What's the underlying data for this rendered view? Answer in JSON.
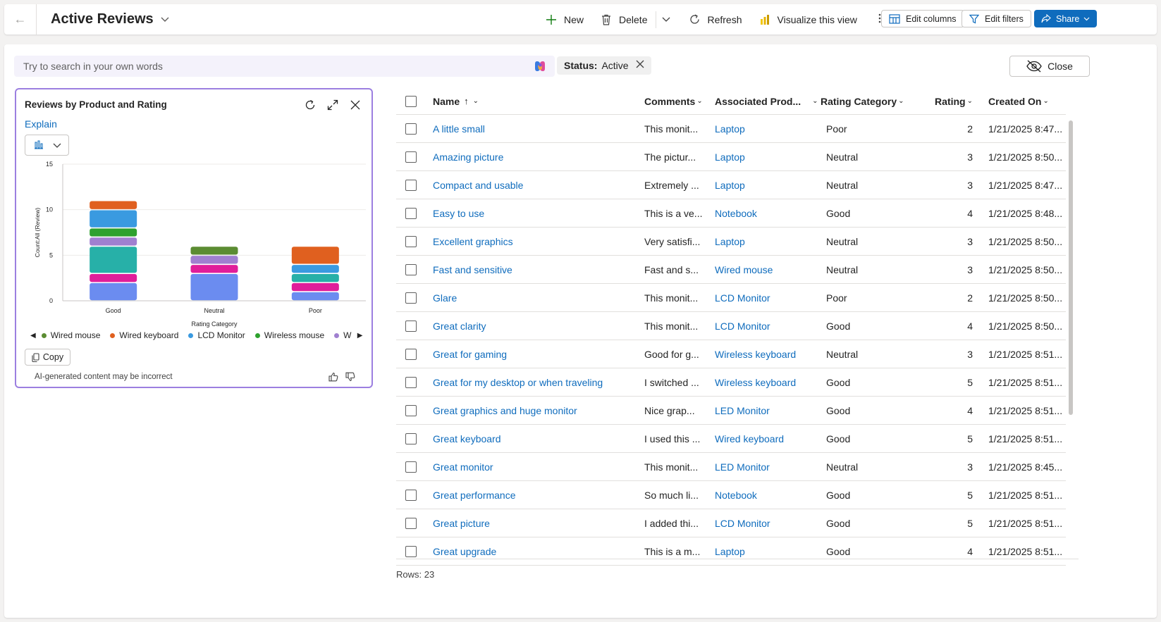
{
  "header": {
    "title": "Active Reviews",
    "actions": {
      "new": "New",
      "delete": "Delete",
      "refresh": "Refresh",
      "visualize": "Visualize this view",
      "edit_columns": "Edit columns",
      "edit_filters": "Edit filters",
      "share": "Share"
    }
  },
  "search": {
    "placeholder": "Try to search in your own words"
  },
  "filter_chip": {
    "label": "Status:",
    "value": "Active"
  },
  "close_button": "Close",
  "chart_card": {
    "title": "Reviews by Product and Rating",
    "explain": "Explain",
    "copy": "Copy",
    "disclaimer": "AI-generated content may be incorrect"
  },
  "chart_data": {
    "type": "bar",
    "stacked": true,
    "title": "Reviews by Product and Rating",
    "xlabel": "Rating Category",
    "ylabel": "Count:All (Review)",
    "categories": [
      "Good",
      "Neutral",
      "Poor"
    ],
    "ylim": [
      0,
      15
    ],
    "yticks": [
      0,
      5,
      10,
      15
    ],
    "series": [
      {
        "name": "Wired mouse",
        "color": "#5b8c32",
        "values": [
          0,
          0,
          0
        ]
      },
      {
        "name": "Wired keyboard",
        "color": "#e0601f",
        "values": [
          0,
          0,
          0
        ]
      },
      {
        "name": "LCD Monitor",
        "color": "#3a9ae0",
        "values": [
          0,
          0,
          0
        ]
      },
      {
        "name": "Wireless mouse",
        "color": "#2ea12e",
        "values": [
          0,
          0,
          0
        ]
      },
      {
        "name": "W",
        "color": "#a080d0",
        "values": [
          0,
          0,
          0
        ]
      }
    ],
    "stacks": [
      [
        {
          "value": 2,
          "color": "#6b8cf0"
        },
        {
          "value": 1,
          "color": "#e01e9a"
        },
        {
          "value": 3,
          "color": "#27b0a8"
        },
        {
          "value": 1,
          "color": "#a080d0"
        },
        {
          "value": 1,
          "color": "#2ea12e"
        },
        {
          "value": 2,
          "color": "#3a9ae0"
        },
        {
          "value": 1,
          "color": "#e0601f"
        }
      ],
      [
        {
          "value": 3,
          "color": "#6b8cf0"
        },
        {
          "value": 1,
          "color": "#e01e9a"
        },
        {
          "value": 1,
          "color": "#a080d0"
        },
        {
          "value": 1,
          "color": "#5b8c32"
        }
      ],
      [
        {
          "value": 1,
          "color": "#6b8cf0"
        },
        {
          "value": 1,
          "color": "#e01e9a"
        },
        {
          "value": 1,
          "color": "#27b0a8"
        },
        {
          "value": 1,
          "color": "#3a9ae0"
        },
        {
          "value": 2,
          "color": "#e0601f"
        }
      ]
    ],
    "legend": [
      "Wired mouse",
      "Wired keyboard",
      "LCD Monitor",
      "Wireless mouse",
      "W"
    ],
    "legend_colors": [
      "#5b8c32",
      "#e0601f",
      "#3a9ae0",
      "#2ea12e",
      "#a080d0"
    ]
  },
  "grid": {
    "columns": [
      "Name",
      "Comments",
      "Associated Prod...",
      "Rating Category",
      "Rating",
      "Created On"
    ],
    "rows": [
      {
        "name": "A little small",
        "comments": "This monit...",
        "product": "Laptop",
        "rating_category": "Poor",
        "rating": "2",
        "created_on": "1/21/2025 8:47..."
      },
      {
        "name": "Amazing picture",
        "comments": "The pictur...",
        "product": "Laptop",
        "rating_category": "Neutral",
        "rating": "3",
        "created_on": "1/21/2025 8:50..."
      },
      {
        "name": "Compact and usable",
        "comments": "Extremely ...",
        "product": "Laptop",
        "rating_category": "Neutral",
        "rating": "3",
        "created_on": "1/21/2025 8:47..."
      },
      {
        "name": "Easy to use",
        "comments": "This is a ve...",
        "product": "Notebook",
        "rating_category": "Good",
        "rating": "4",
        "created_on": "1/21/2025 8:48..."
      },
      {
        "name": "Excellent graphics",
        "comments": "Very satisfi...",
        "product": "Laptop",
        "rating_category": "Neutral",
        "rating": "3",
        "created_on": "1/21/2025 8:50..."
      },
      {
        "name": "Fast and sensitive",
        "comments": "Fast and s...",
        "product": "Wired mouse",
        "rating_category": "Neutral",
        "rating": "3",
        "created_on": "1/21/2025 8:50..."
      },
      {
        "name": "Glare",
        "comments": "This monit...",
        "product": "LCD Monitor",
        "rating_category": "Poor",
        "rating": "2",
        "created_on": "1/21/2025 8:50..."
      },
      {
        "name": "Great clarity",
        "comments": "This monit...",
        "product": "LCD Monitor",
        "rating_category": "Good",
        "rating": "4",
        "created_on": "1/21/2025 8:50..."
      },
      {
        "name": "Great for gaming",
        "comments": "Good for g...",
        "product": "Wireless keyboard",
        "rating_category": "Neutral",
        "rating": "3",
        "created_on": "1/21/2025 8:51..."
      },
      {
        "name": "Great for my desktop or when traveling",
        "comments": "I switched ...",
        "product": "Wireless keyboard",
        "rating_category": "Good",
        "rating": "5",
        "created_on": "1/21/2025 8:51..."
      },
      {
        "name": "Great graphics and huge monitor",
        "comments": "Nice grap...",
        "product": "LED Monitor",
        "rating_category": "Good",
        "rating": "4",
        "created_on": "1/21/2025 8:51..."
      },
      {
        "name": "Great keyboard",
        "comments": "I used this ...",
        "product": "Wired keyboard",
        "rating_category": "Good",
        "rating": "5",
        "created_on": "1/21/2025 8:51..."
      },
      {
        "name": "Great monitor",
        "comments": "This monit...",
        "product": "LED Monitor",
        "rating_category": "Neutral",
        "rating": "3",
        "created_on": "1/21/2025 8:45..."
      },
      {
        "name": "Great performance",
        "comments": "So much li...",
        "product": "Notebook",
        "rating_category": "Good",
        "rating": "5",
        "created_on": "1/21/2025 8:51..."
      },
      {
        "name": "Great picture",
        "comments": "I added thi...",
        "product": "LCD Monitor",
        "rating_category": "Good",
        "rating": "5",
        "created_on": "1/21/2025 8:51..."
      },
      {
        "name": "Great upgrade",
        "comments": "This is a m...",
        "product": "Laptop",
        "rating_category": "Good",
        "rating": "4",
        "created_on": "1/21/2025 8:51..."
      }
    ],
    "rows_label": "Rows: 23"
  }
}
